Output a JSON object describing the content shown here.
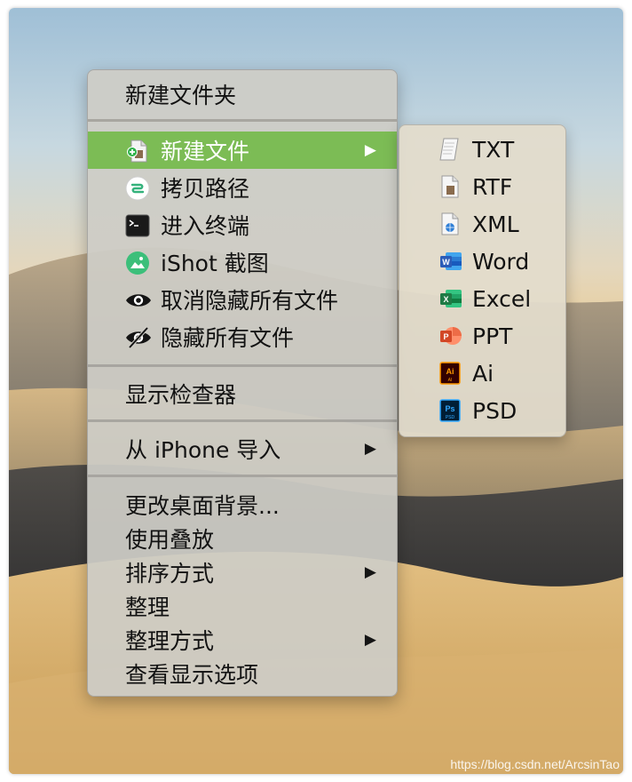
{
  "menu": {
    "new_folder": "新建文件夹",
    "new_file": "新建文件",
    "copy_path": "拷贝路径",
    "open_terminal": "进入终端",
    "ishot": "iShot 截图",
    "unhide_all": "取消隐藏所有文件",
    "hide_all": "隐藏所有文件",
    "inspector": "显示检查器",
    "import_iphone": "从 iPhone 导入",
    "change_bg": "更改桌面背景...",
    "use_stacks": "使用叠放",
    "sort_by": "排序方式",
    "clean_up": "整理",
    "clean_up_by": "整理方式",
    "view_options": "查看显示选项",
    "arrow_glyph": "▶"
  },
  "submenu": {
    "items": [
      "TXT",
      "RTF",
      "XML",
      "Word",
      "Excel",
      "PPT",
      "Ai",
      "PSD"
    ]
  },
  "icons": {
    "new_file": "document-plus-icon",
    "copy_path": "path-copy-icon",
    "terminal": "terminal-icon",
    "ishot": "ishot-icon",
    "eye": "eye-icon",
    "eye_slash": "eye-slash-icon",
    "txt": "text-file-icon",
    "rtf": "rtf-file-icon",
    "xml": "xml-file-icon",
    "word": "word-icon",
    "excel": "excel-icon",
    "ppt": "powerpoint-icon",
    "ai": "illustrator-icon",
    "psd": "photoshop-icon"
  },
  "colors": {
    "highlight": "#7cbc55",
    "word": "#2b5cb8",
    "excel": "#1f7a45",
    "ppt": "#d24726",
    "ai": "#ff9a00",
    "psd": "#31a8ff"
  },
  "watermark": "https://blog.csdn.net/ArcsinTao"
}
